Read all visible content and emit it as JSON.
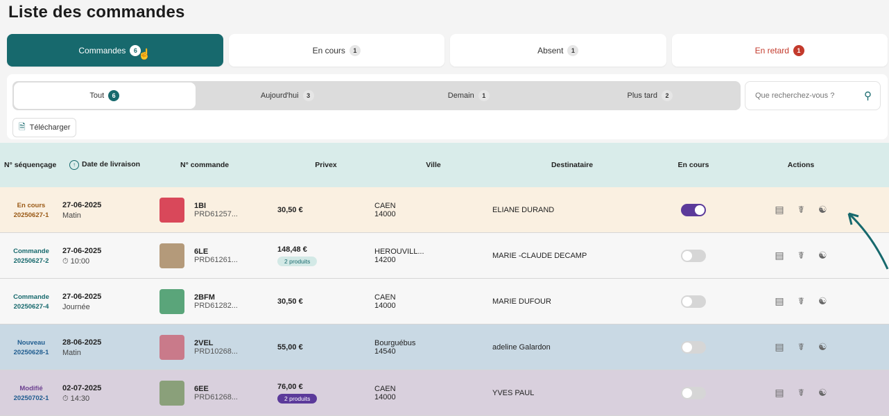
{
  "title": "Liste des commandes",
  "main_tabs": [
    {
      "label": "Commandes",
      "count": "6"
    },
    {
      "label": "En cours",
      "count": "1"
    },
    {
      "label": "Absent",
      "count": "1"
    },
    {
      "label": "En retard",
      "count": "1"
    }
  ],
  "sub_tabs": [
    {
      "label": "Tout",
      "count": "6"
    },
    {
      "label": "Aujourd'hui",
      "count": "3"
    },
    {
      "label": "Demain",
      "count": "1"
    },
    {
      "label": "Plus tard",
      "count": "2"
    }
  ],
  "search": {
    "placeholder": "Que recherchez-vous ?"
  },
  "download_label": "Télécharger",
  "headers": {
    "seq": "N° séquençage",
    "date": "Date de livraison",
    "order": "N° commande",
    "privex": "Privex",
    "city": "Ville",
    "recipient": "Destinataire",
    "in_progress": "En cours",
    "actions": "Actions"
  },
  "rows": [
    {
      "status": "En cours",
      "seq": "20250627-1",
      "date": "27-06-2025",
      "slot": "Matin",
      "num": "1BI",
      "ref": "PRD61257...",
      "price": "30,50 €",
      "products": "",
      "city": "CAEN",
      "zip": "14000",
      "recipient": "ELIANE DURAND",
      "toggle_on": true,
      "bg": "#faf0e1",
      "status_color": "#9a5a16",
      "seq_color": "#9a5a16",
      "thumb": "#d9485a"
    },
    {
      "status": "Commande",
      "seq": "20250627-2",
      "date": "27-06-2025",
      "slot": "10:00",
      "num": "6LE",
      "ref": "PRD61261...",
      "price": "148,48 €",
      "products": "2 produits",
      "city": "HEROUVILL...",
      "zip": "14200",
      "recipient": "MARIE -CLAUDE DECAMP",
      "toggle_on": false,
      "bg": "#f7f7f7",
      "status_color": "#17696d",
      "seq_color": "#17696d",
      "thumb": "#b49a7a"
    },
    {
      "status": "Commande",
      "seq": "20250627-4",
      "date": "27-06-2025",
      "slot": "Journée",
      "num": "2BFM",
      "ref": "PRD61282...",
      "price": "30,50 €",
      "products": "",
      "city": "CAEN",
      "zip": "14000",
      "recipient": "MARIE DUFOUR",
      "toggle_on": false,
      "bg": "#f7f7f7",
      "status_color": "#17696d",
      "seq_color": "#17696d",
      "thumb": "#5aa57a"
    },
    {
      "status": "Nouveau",
      "seq": "20250628-1",
      "date": "28-06-2025",
      "slot": "Matin",
      "num": "2VEL",
      "ref": "PRD10268...",
      "price": "55,00 €",
      "products": "",
      "city": "Bourguébus",
      "zip": "14540",
      "recipient": "adeline Galardon",
      "toggle_on": false,
      "bg": "#c9d9e4",
      "status_color": "#1f5c8f",
      "seq_color": "#1f5c8f",
      "thumb": "#c97a8a"
    },
    {
      "status": "Modifié",
      "seq": "20250702-1",
      "date": "02-07-2025",
      "slot": "14:30",
      "num": "6EE",
      "ref": "PRD61268...",
      "price": "76,00 €",
      "products": "2 produits",
      "city": "CAEN",
      "zip": "14000",
      "recipient": "YVES PAUL",
      "toggle_on": false,
      "bg": "#d9d0dd",
      "status_color": "#6b3f8f",
      "seq_color": "#1f5c8f",
      "thumb": "#8aa07a"
    }
  ],
  "colors": {
    "accent": "#17696d",
    "late": "#c33a2c",
    "toggle_on": "#5b3a9a"
  }
}
